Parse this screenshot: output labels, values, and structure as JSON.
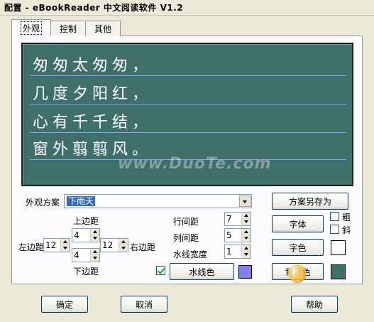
{
  "window": {
    "title": "配置 - eBookReader 中文阅读软件 V1.2"
  },
  "tabs": [
    {
      "label": "外观",
      "active": true
    },
    {
      "label": "控制",
      "active": false
    },
    {
      "label": "其他",
      "active": false
    }
  ],
  "preview": {
    "lines": [
      "匆匆太匆匆，",
      "几度夕阳红，",
      "心有千千结，",
      "窗外翦翦风。"
    ],
    "background_color": "#3f6f69",
    "rule_color": "#8aa0ff",
    "watermark": "www.DuoTe.com"
  },
  "appearance": {
    "scheme_label": "外观方案",
    "scheme_value": "下雨天",
    "save_as_label": "方案另存为"
  },
  "margins": {
    "top_label": "上边距",
    "top_value": "4",
    "left_label": "左边距",
    "left_value": "12",
    "right_label": "右边距",
    "right_value": "12",
    "bottom_label": "下边距",
    "bottom_value": "4"
  },
  "spacing": {
    "row_label": "行间距",
    "row_value": "7",
    "col_label": "列间距",
    "col_value": "5",
    "line_width_label": "水线宽度",
    "line_width_value": "1"
  },
  "font": {
    "font_label": "字体",
    "bold_label": "粗",
    "bold_checked": false,
    "italic_label": "斜",
    "italic_checked": false,
    "color_label": "字色",
    "color_value": "#ffffff"
  },
  "waterline": {
    "checked": true,
    "label": "水线色",
    "color": "#8080ff"
  },
  "background": {
    "label": "背景色",
    "color": "#3f6f69"
  },
  "footer": {
    "ok_label": "确定",
    "cancel_label": "取消",
    "help_label": "帮助"
  },
  "sitemark": {
    "brand": "",
    "url": "",
    "slogan": ""
  }
}
